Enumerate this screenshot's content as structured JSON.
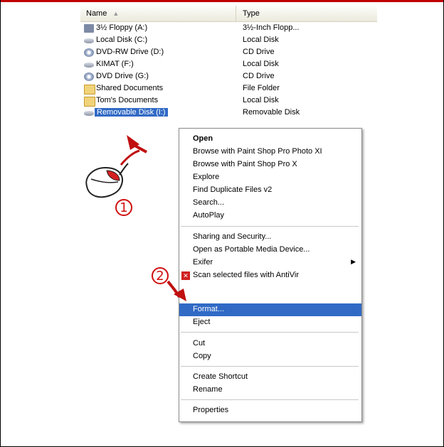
{
  "explorer": {
    "columns": {
      "name": "Name",
      "type": "Type"
    },
    "rows": [
      {
        "name": "3½ Floppy (A:)",
        "type": "3½-Inch Flopp...",
        "icon": "floppy-icon"
      },
      {
        "name": "Local Disk (C:)",
        "type": "Local Disk",
        "icon": "disk-icon"
      },
      {
        "name": "DVD-RW Drive (D:)",
        "type": "CD Drive",
        "icon": "cd-drive-icon"
      },
      {
        "name": "KIMAT (F:)",
        "type": "Local Disk",
        "icon": "disk-icon"
      },
      {
        "name": "DVD Drive (G:)",
        "type": "CD Drive",
        "icon": "cd-drive-icon"
      },
      {
        "name": "Shared Documents",
        "type": "File Folder",
        "icon": "folder-icon"
      },
      {
        "name": "Tom's Documents",
        "type": "Local Disk",
        "icon": "folder-icon"
      },
      {
        "name": "Removable Disk (I:)",
        "type": "Removable Disk",
        "icon": "removable-disk-icon"
      }
    ]
  },
  "context_menu": {
    "items": [
      "Open",
      "Browse with Paint Shop Pro Photo XI",
      "Browse with Paint Shop Pro X",
      "Explore",
      "Find Duplicate Files v2",
      "Search...",
      "AutoPlay",
      "Sharing and Security...",
      "Open as Portable Media Device...",
      "Exifer",
      "Scan selected files with AntiVir",
      "Format...",
      "Eject",
      "Cut",
      "Copy",
      "Create Shortcut",
      "Rename",
      "Properties"
    ]
  },
  "annotations": {
    "step1": "1",
    "step2": "2"
  },
  "colors": {
    "selection": "#316ac5",
    "annotation": "#d01010"
  }
}
